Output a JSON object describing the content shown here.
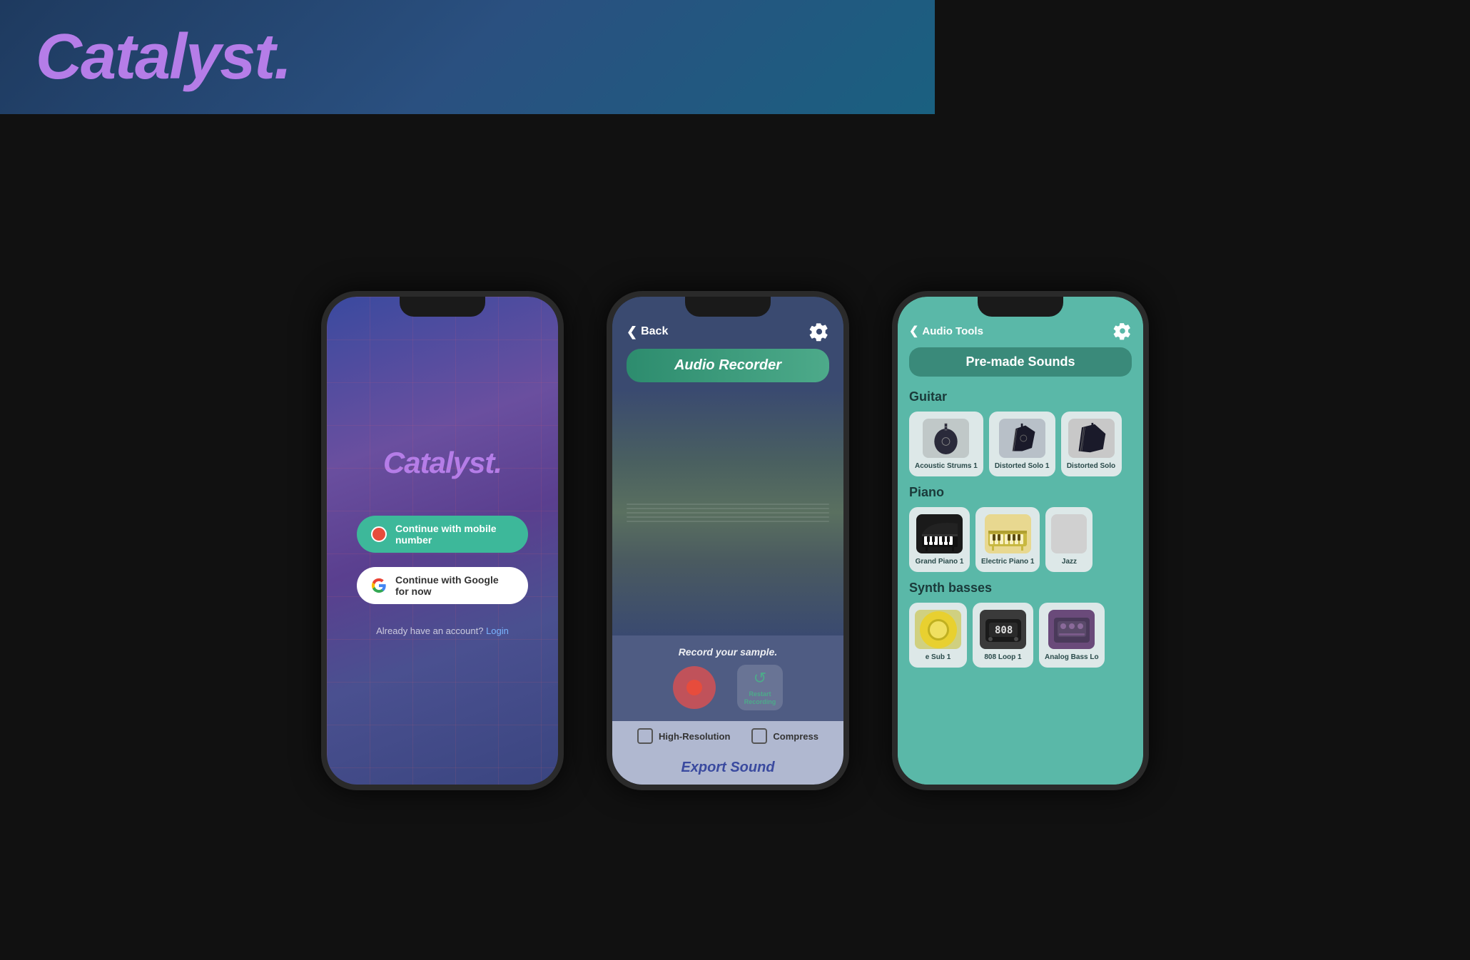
{
  "header": {
    "logo": "Catalyst.",
    "background": "#1e3a5f"
  },
  "phone1": {
    "title": "Catalyst.",
    "mobile_btn": "Continue with mobile number",
    "google_btn": "Continue with Google for now",
    "footer_text": "Already have an account?",
    "login_link": "Login"
  },
  "phone2": {
    "back_label": "Back",
    "title": "Audio Recorder",
    "record_label": "Record your sample.",
    "restart_label": "Restart\nRecording",
    "high_res_label": "High-Resolution",
    "compress_label": "Compress",
    "export_label": "Export Sound"
  },
  "phone3": {
    "back_label": "Audio Tools",
    "title": "Pre-made Sounds",
    "sections": [
      {
        "name": "Guitar",
        "label": "",
        "items": [
          {
            "label": "Acoustic Strums 1",
            "type": "guitar-acoustic"
          },
          {
            "label": "Distorted Solo 1",
            "type": "guitar-distorted1"
          },
          {
            "label": "Distorted Solo",
            "type": "guitar-distorted2"
          }
        ]
      },
      {
        "name": "Piano",
        "items": [
          {
            "label": "Grand Piano 1",
            "type": "piano-grand"
          },
          {
            "label": "Electric Piano 1",
            "type": "piano-electric"
          },
          {
            "label": "Jazz",
            "type": "piano-jazz"
          }
        ]
      },
      {
        "name": "Synth basses",
        "items": [
          {
            "label": "Sub 1",
            "type": "bass-sub"
          },
          {
            "label": "808 Loop 1",
            "type": "bass-808"
          },
          {
            "label": "Analog Bass Lo",
            "type": "bass-analog"
          }
        ]
      }
    ]
  }
}
